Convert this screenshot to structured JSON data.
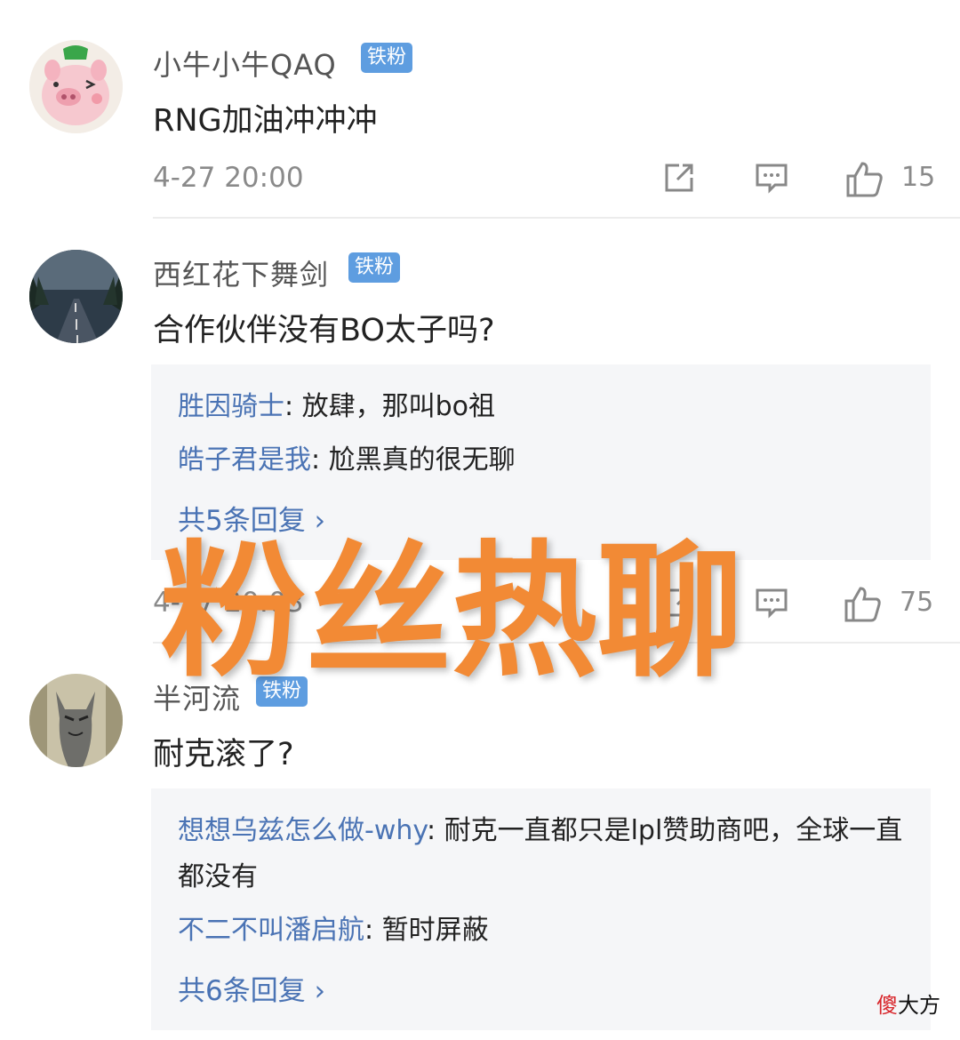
{
  "comments": [
    {
      "username": "小牛小牛QAQ",
      "badge": "铁粉",
      "text": "RNG加油冲冲冲",
      "time": "4-27 20:00",
      "likes": "15"
    },
    {
      "username": "西红花下舞剑",
      "badge": "铁粉",
      "text": "合作伙伴没有BO太子吗?",
      "replies": [
        {
          "name": "胜因骑士",
          "text": ": 放肆，那叫bo祖"
        },
        {
          "name": "皓子君是我",
          "text": ": 尬黑真的很无聊"
        }
      ],
      "more": "共5条回复 ›",
      "time": "4-27 20:03",
      "likes": "75"
    },
    {
      "username": "半河流",
      "badge": "铁粉",
      "text": "耐克滚了?",
      "replies": [
        {
          "name": "想想乌兹怎么做-why",
          "text": ": 耐克一直都只是lpl赞助商吧，全球一直都没有"
        },
        {
          "name": "不二不叫潘启航",
          "text": ": 暂时屏蔽"
        }
      ],
      "more": "共6条回复 ›"
    }
  ],
  "overlay_text": "粉丝热聊",
  "watermark": {
    "red": "傻",
    "black": "大方"
  },
  "colors": {
    "accent_blue": "#4a73b4",
    "badge_blue": "#5e9de0",
    "overlay_orange": "#f28a35"
  }
}
